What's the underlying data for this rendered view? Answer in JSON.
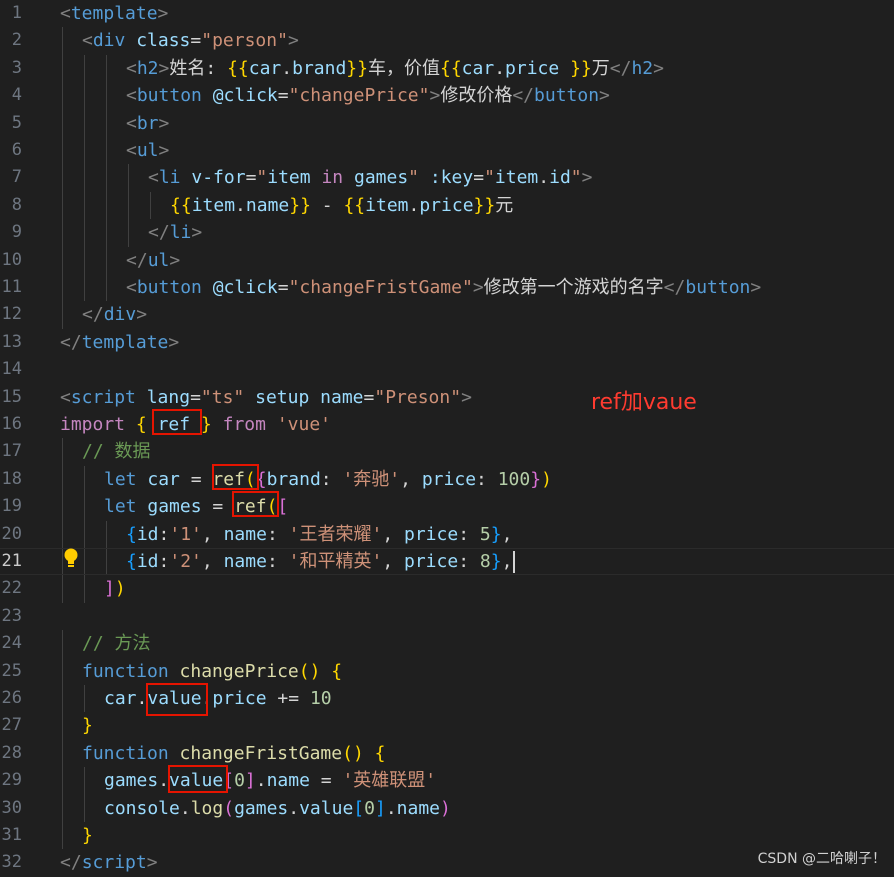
{
  "editor": {
    "lines": [
      {
        "n": "1",
        "indent": 0,
        "tokens": [
          [
            "tg",
            "<"
          ],
          [
            "tn",
            "template"
          ],
          [
            "tg",
            ">"
          ]
        ]
      },
      {
        "n": "2",
        "indent": 1,
        "tokens": [
          [
            "tg",
            "<"
          ],
          [
            "tn",
            "div"
          ],
          [
            "pl",
            " "
          ],
          [
            "at",
            "class"
          ],
          [
            "pl",
            "="
          ],
          [
            "st",
            "\"person\""
          ],
          [
            "tg",
            ">"
          ]
        ]
      },
      {
        "n": "3",
        "indent": 3,
        "tokens": [
          [
            "tg",
            "<"
          ],
          [
            "tn",
            "h2"
          ],
          [
            "tg",
            ">"
          ],
          [
            "pl",
            "姓名: "
          ],
          [
            "b1",
            "{{"
          ],
          [
            "vr",
            "car"
          ],
          [
            "pl",
            "."
          ],
          [
            "vr",
            "brand"
          ],
          [
            "b1",
            "}}"
          ],
          [
            "pl",
            "车，价值"
          ],
          [
            "b1",
            "{{"
          ],
          [
            "vr",
            "car"
          ],
          [
            "pl",
            "."
          ],
          [
            "vr",
            "price"
          ],
          [
            "pl",
            " "
          ],
          [
            "b1",
            "}}"
          ],
          [
            "pl",
            "万"
          ],
          [
            "tg",
            "</"
          ],
          [
            "tn",
            "h2"
          ],
          [
            "tg",
            ">"
          ]
        ]
      },
      {
        "n": "4",
        "indent": 3,
        "tokens": [
          [
            "tg",
            "<"
          ],
          [
            "tn",
            "button"
          ],
          [
            "pl",
            " "
          ],
          [
            "at",
            "@click"
          ],
          [
            "pl",
            "="
          ],
          [
            "st",
            "\"changePrice\""
          ],
          [
            "tg",
            ">"
          ],
          [
            "pl",
            "修改价格"
          ],
          [
            "tg",
            "</"
          ],
          [
            "tn",
            "button"
          ],
          [
            "tg",
            ">"
          ]
        ]
      },
      {
        "n": "5",
        "indent": 3,
        "tokens": [
          [
            "tg",
            "<"
          ],
          [
            "tn",
            "br"
          ],
          [
            "tg",
            ">"
          ]
        ]
      },
      {
        "n": "6",
        "indent": 3,
        "tokens": [
          [
            "tg",
            "<"
          ],
          [
            "tn",
            "ul"
          ],
          [
            "tg",
            ">"
          ]
        ]
      },
      {
        "n": "7",
        "indent": 4,
        "tokens": [
          [
            "tg",
            "<"
          ],
          [
            "tn",
            "li"
          ],
          [
            "pl",
            " "
          ],
          [
            "at",
            "v-for"
          ],
          [
            "pl",
            "="
          ],
          [
            "st",
            "\""
          ],
          [
            "vr",
            "item"
          ],
          [
            "pl",
            " "
          ],
          [
            "cf",
            "in"
          ],
          [
            "pl",
            " "
          ],
          [
            "vr",
            "games"
          ],
          [
            "st",
            "\""
          ],
          [
            "pl",
            " "
          ],
          [
            "at",
            ":key"
          ],
          [
            "pl",
            "="
          ],
          [
            "st",
            "\""
          ],
          [
            "vr",
            "item"
          ],
          [
            "pl",
            "."
          ],
          [
            "vr",
            "id"
          ],
          [
            "st",
            "\""
          ],
          [
            "tg",
            ">"
          ]
        ]
      },
      {
        "n": "8",
        "indent": 5,
        "tokens": [
          [
            "b1",
            "{{"
          ],
          [
            "vr",
            "item"
          ],
          [
            "pl",
            "."
          ],
          [
            "vr",
            "name"
          ],
          [
            "b1",
            "}}"
          ],
          [
            "pl",
            " - "
          ],
          [
            "b1",
            "{{"
          ],
          [
            "vr",
            "item"
          ],
          [
            "pl",
            "."
          ],
          [
            "vr",
            "price"
          ],
          [
            "b1",
            "}}"
          ],
          [
            "pl",
            "元"
          ]
        ]
      },
      {
        "n": "9",
        "indent": 4,
        "tokens": [
          [
            "tg",
            "</"
          ],
          [
            "tn",
            "li"
          ],
          [
            "tg",
            ">"
          ]
        ]
      },
      {
        "n": "10",
        "indent": 3,
        "tokens": [
          [
            "tg",
            "</"
          ],
          [
            "tn",
            "ul"
          ],
          [
            "tg",
            ">"
          ]
        ]
      },
      {
        "n": "11",
        "indent": 3,
        "tokens": [
          [
            "tg",
            "<"
          ],
          [
            "tn",
            "button"
          ],
          [
            "pl",
            " "
          ],
          [
            "at",
            "@click"
          ],
          [
            "pl",
            "="
          ],
          [
            "st",
            "\"changeFristGame\""
          ],
          [
            "tg",
            ">"
          ],
          [
            "pl",
            "修改第一个游戏的名字"
          ],
          [
            "tg",
            "</"
          ],
          [
            "tn",
            "button"
          ],
          [
            "tg",
            ">"
          ]
        ]
      },
      {
        "n": "12",
        "indent": 1,
        "tokens": [
          [
            "tg",
            "</"
          ],
          [
            "tn",
            "div"
          ],
          [
            "tg",
            ">"
          ]
        ]
      },
      {
        "n": "13",
        "indent": 0,
        "tokens": [
          [
            "tg",
            "</"
          ],
          [
            "tn",
            "template"
          ],
          [
            "tg",
            ">"
          ]
        ]
      },
      {
        "n": "14",
        "indent": 0,
        "tokens": []
      },
      {
        "n": "15",
        "indent": 0,
        "tokens": [
          [
            "tg",
            "<"
          ],
          [
            "tn",
            "script"
          ],
          [
            "pl",
            " "
          ],
          [
            "at",
            "lang"
          ],
          [
            "pl",
            "="
          ],
          [
            "st",
            "\"ts\""
          ],
          [
            "pl",
            " "
          ],
          [
            "at",
            "setup"
          ],
          [
            "pl",
            " "
          ],
          [
            "at",
            "name"
          ],
          [
            "pl",
            "="
          ],
          [
            "st",
            "\"Preson\""
          ],
          [
            "tg",
            ">"
          ]
        ]
      },
      {
        "n": "16",
        "indent": 0,
        "tokens": [
          [
            "cf",
            "import"
          ],
          [
            "pl",
            " "
          ],
          [
            "b1",
            "{"
          ],
          [
            "pl",
            " "
          ],
          [
            "vr",
            "ref"
          ],
          [
            "pl",
            " "
          ],
          [
            "b1",
            "}"
          ],
          [
            "pl",
            " "
          ],
          [
            "cf",
            "from"
          ],
          [
            "pl",
            " "
          ],
          [
            "st",
            "'vue'"
          ]
        ]
      },
      {
        "n": "17",
        "indent": 1,
        "tokens": [
          [
            "cm",
            "// 数据"
          ]
        ]
      },
      {
        "n": "18",
        "indent": 2,
        "tokens": [
          [
            "kw",
            "let"
          ],
          [
            "pl",
            " "
          ],
          [
            "vr",
            "car"
          ],
          [
            "pl",
            " = "
          ],
          [
            "fn",
            "ref"
          ],
          [
            "b1",
            "("
          ],
          [
            "b2",
            "{"
          ],
          [
            "vr",
            "brand"
          ],
          [
            "pl",
            ": "
          ],
          [
            "st",
            "'奔驰'"
          ],
          [
            "pl",
            ", "
          ],
          [
            "vr",
            "price"
          ],
          [
            "pl",
            ": "
          ],
          [
            "nm",
            "100"
          ],
          [
            "b2",
            "}"
          ],
          [
            "b1",
            ")"
          ]
        ]
      },
      {
        "n": "19",
        "indent": 2,
        "tokens": [
          [
            "kw",
            "let"
          ],
          [
            "pl",
            " "
          ],
          [
            "vr",
            "games"
          ],
          [
            "pl",
            " = "
          ],
          [
            "fn",
            "ref"
          ],
          [
            "b1",
            "("
          ],
          [
            "b2",
            "["
          ]
        ]
      },
      {
        "n": "20",
        "indent": 3,
        "tokens": [
          [
            "b3",
            "{"
          ],
          [
            "vr",
            "id"
          ],
          [
            "pl",
            ":"
          ],
          [
            "st",
            "'1'"
          ],
          [
            "pl",
            ", "
          ],
          [
            "vr",
            "name"
          ],
          [
            "pl",
            ": "
          ],
          [
            "st",
            "'王者荣耀'"
          ],
          [
            "pl",
            ", "
          ],
          [
            "vr",
            "price"
          ],
          [
            "pl",
            ": "
          ],
          [
            "nm",
            "5"
          ],
          [
            "b3",
            "}"
          ],
          [
            "pl",
            ","
          ]
        ]
      },
      {
        "n": "21",
        "indent": 3,
        "tokens": [
          [
            "b3",
            "{"
          ],
          [
            "vr",
            "id"
          ],
          [
            "pl",
            ":"
          ],
          [
            "st",
            "'2'"
          ],
          [
            "pl",
            ", "
          ],
          [
            "vr",
            "name"
          ],
          [
            "pl",
            ": "
          ],
          [
            "st",
            "'和平精英'"
          ],
          [
            "pl",
            ", "
          ],
          [
            "vr",
            "price"
          ],
          [
            "pl",
            ": "
          ],
          [
            "nm",
            "8"
          ],
          [
            "b3",
            "}"
          ],
          [
            "pl",
            ","
          ]
        ]
      },
      {
        "n": "22",
        "indent": 2,
        "tokens": [
          [
            "b2",
            "]"
          ],
          [
            "b1",
            ")"
          ]
        ]
      },
      {
        "n": "23",
        "indent": 0,
        "tokens": []
      },
      {
        "n": "24",
        "indent": 1,
        "tokens": [
          [
            "cm",
            "// 方法"
          ]
        ]
      },
      {
        "n": "25",
        "indent": 1,
        "tokens": [
          [
            "kw",
            "function"
          ],
          [
            "pl",
            " "
          ],
          [
            "fn",
            "changePrice"
          ],
          [
            "b1",
            "()"
          ],
          [
            "pl",
            " "
          ],
          [
            "b1",
            "{"
          ]
        ]
      },
      {
        "n": "26",
        "indent": 2,
        "tokens": [
          [
            "vr",
            "car"
          ],
          [
            "pl",
            "."
          ],
          [
            "vr",
            "value"
          ],
          [
            "pl",
            "."
          ],
          [
            "vr",
            "price"
          ],
          [
            "pl",
            " += "
          ],
          [
            "nm",
            "10"
          ]
        ]
      },
      {
        "n": "27",
        "indent": 1,
        "tokens": [
          [
            "b1",
            "}"
          ]
        ]
      },
      {
        "n": "28",
        "indent": 1,
        "tokens": [
          [
            "kw",
            "function"
          ],
          [
            "pl",
            " "
          ],
          [
            "fn",
            "changeFristGame"
          ],
          [
            "b1",
            "()"
          ],
          [
            "pl",
            " "
          ],
          [
            "b1",
            "{"
          ]
        ]
      },
      {
        "n": "29",
        "indent": 2,
        "tokens": [
          [
            "vr",
            "games"
          ],
          [
            "pl",
            "."
          ],
          [
            "vr",
            "value"
          ],
          [
            "b2",
            "["
          ],
          [
            "nm",
            "0"
          ],
          [
            "b2",
            "]"
          ],
          [
            "pl",
            "."
          ],
          [
            "vr",
            "name"
          ],
          [
            "pl",
            " = "
          ],
          [
            "st",
            "'英雄联盟'"
          ]
        ]
      },
      {
        "n": "30",
        "indent": 2,
        "tokens": [
          [
            "vr",
            "console"
          ],
          [
            "pl",
            "."
          ],
          [
            "fn",
            "log"
          ],
          [
            "b2",
            "("
          ],
          [
            "vr",
            "games"
          ],
          [
            "pl",
            "."
          ],
          [
            "vr",
            "value"
          ],
          [
            "b3",
            "["
          ],
          [
            "nm",
            "0"
          ],
          [
            "b3",
            "]"
          ],
          [
            "pl",
            "."
          ],
          [
            "vr",
            "name"
          ],
          [
            "b2",
            ")"
          ]
        ]
      },
      {
        "n": "31",
        "indent": 1,
        "tokens": [
          [
            "b1",
            "}"
          ]
        ]
      },
      {
        "n": "32",
        "indent": 0,
        "tokens": [
          [
            "tg",
            "</"
          ],
          [
            "tn",
            "script"
          ],
          [
            "tg",
            ">"
          ]
        ]
      }
    ],
    "current_line": "21"
  },
  "annotation": {
    "text": "ref加vaue",
    "color": "#ff3b30"
  },
  "watermark": {
    "text": "CSDN @二哈喇子！"
  },
  "icons": {
    "lightbulb": "lightbulb-icon"
  },
  "colors": {
    "background": "#1f1f1f",
    "highlight_box": "#e51400"
  }
}
